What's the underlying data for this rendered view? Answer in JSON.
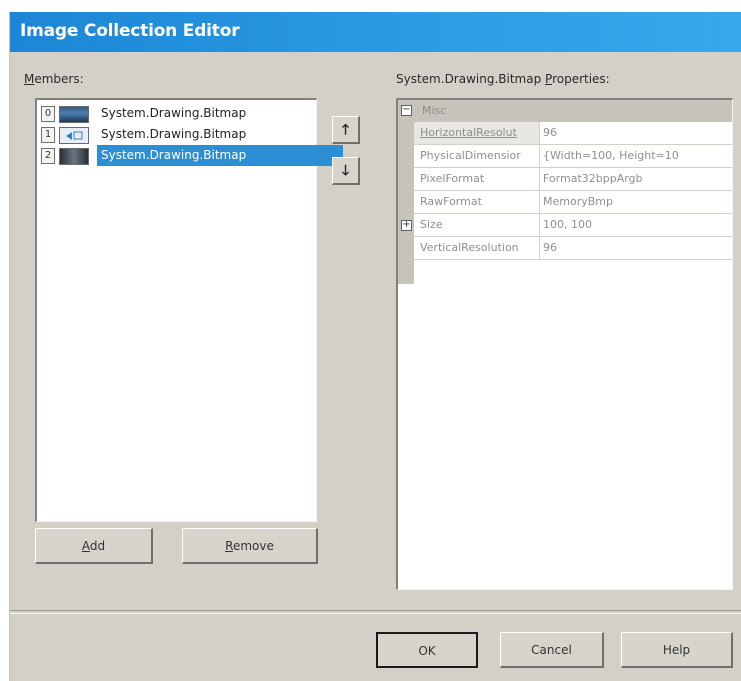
{
  "window": {
    "title": "Image Collection Editor"
  },
  "members": {
    "label_underlined": "M",
    "label_rest": "embers:",
    "items": [
      {
        "index": "0",
        "text": "System.Drawing.Bitmap",
        "selected": false
      },
      {
        "index": "1",
        "text": "System.Drawing.Bitmap",
        "selected": false
      },
      {
        "index": "2",
        "text": "System.Drawing.Bitmap",
        "selected": true
      }
    ],
    "move_up_icon": "up-arrow",
    "move_down_icon": "down-arrow",
    "move_up_glyph": "🡑",
    "move_down_glyph": "🡓"
  },
  "properties": {
    "label_before": "System.Drawing.Bitmap ",
    "label_underlined": "P",
    "label_after": "roperties:",
    "category": "Misc",
    "category_toggle": "−",
    "rows": [
      {
        "name": "HorizontalResolut",
        "value": "96"
      },
      {
        "name": "PhysicalDimensior",
        "value": "{Width=100, Height=10"
      },
      {
        "name": "PixelFormat",
        "value": "Format32bppArgb"
      },
      {
        "name": "RawFormat",
        "value": "MemoryBmp"
      },
      {
        "name": "Size",
        "value": "100, 100",
        "expandable": true
      },
      {
        "name": "VerticalResolution",
        "value": "96"
      }
    ],
    "expand_glyph": "+"
  },
  "buttons": {
    "add_underlined": "A",
    "add_rest": "dd",
    "remove_underlined": "R",
    "remove_rest": "emove",
    "ok": "OK",
    "cancel": "Cancel",
    "help": "Help"
  },
  "colors": {
    "title_bar": "#2b9ee4",
    "selection": "#2c8fd4",
    "dialog_face": "#d4d0c8"
  }
}
